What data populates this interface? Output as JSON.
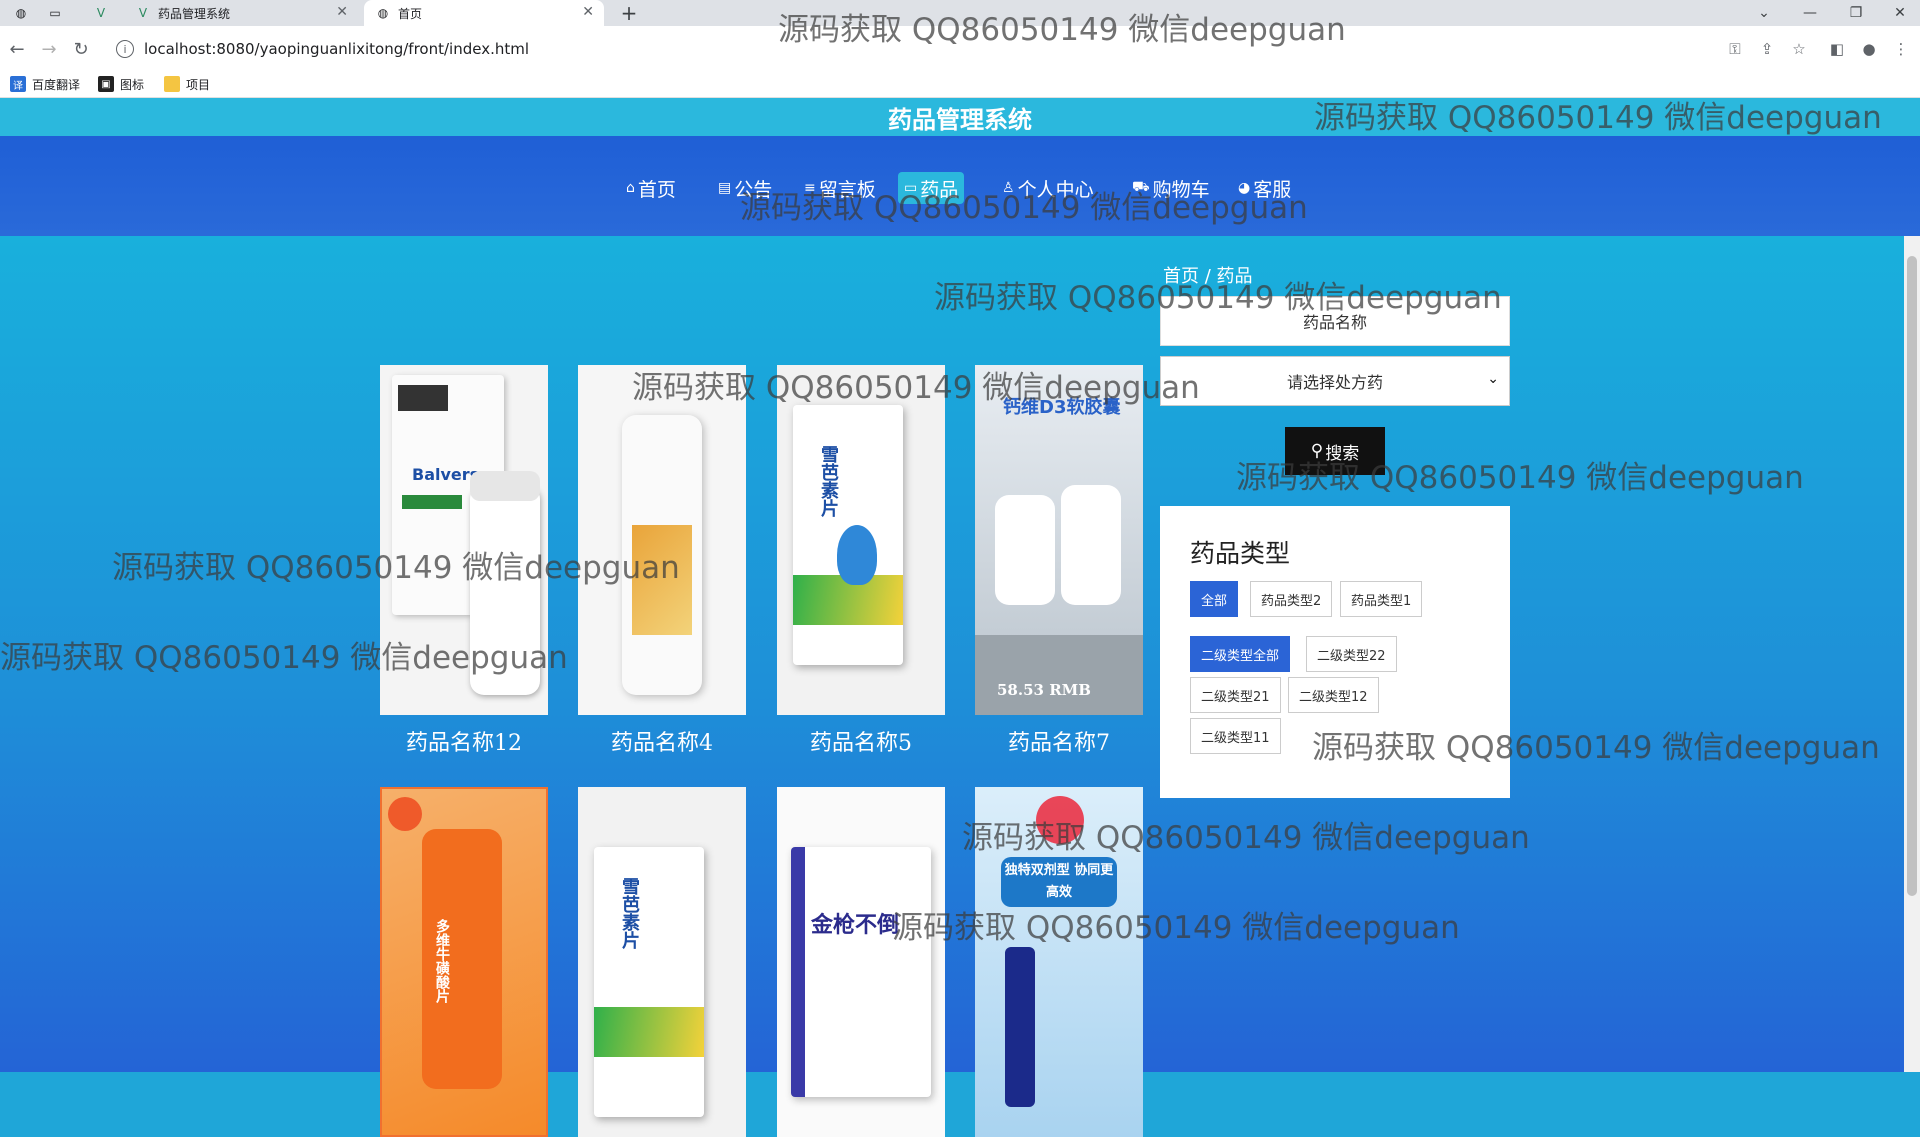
{
  "browser": {
    "tabs": [
      {
        "label": "药品管理系统",
        "active": false
      },
      {
        "label": "首页",
        "active": true
      }
    ],
    "url": "localhost:8080/yaopinguanlixitong/front/index.html",
    "bookmarks": [
      "百度翻译",
      "图标",
      "项目"
    ]
  },
  "site": {
    "title": "药品管理系统",
    "nav": [
      {
        "label": "首页",
        "icon": "home-icon",
        "active": false
      },
      {
        "label": "公告",
        "icon": "notice-icon",
        "active": false
      },
      {
        "label": "留言板",
        "icon": "message-icon",
        "active": false
      },
      {
        "label": "药品",
        "icon": "medicine-icon",
        "active": true
      },
      {
        "label": "个人中心",
        "icon": "user-icon",
        "active": false
      },
      {
        "label": "购物车",
        "icon": "cart-icon",
        "active": false
      },
      {
        "label": "客服",
        "icon": "service-icon",
        "active": false
      }
    ]
  },
  "breadcrumb": "首页 / 药品",
  "search": {
    "placeholder": "药品名称",
    "select_value": "请选择处方药",
    "button_label": "搜索"
  },
  "categories": {
    "title": "药品类型",
    "level1": [
      "全部",
      "药品类型2",
      "药品类型1"
    ],
    "level1_selected": 0,
    "level2": [
      "二级类型全部",
      "二级类型22",
      "二级类型21",
      "二级类型12",
      "二级类型11"
    ],
    "level2_selected": 0
  },
  "products": [
    {
      "name": "药品名称12",
      "image_text": "Balversa"
    },
    {
      "name": "药品名称4",
      "image_text": ""
    },
    {
      "name": "药品名称5",
      "image_text": "雪芭素片"
    },
    {
      "name": "药品名称7",
      "image_text": "钙维D3软胶囊",
      "price": "58.53 RMB"
    },
    {
      "name": "",
      "image_text": "多维牛磺酸片"
    },
    {
      "name": "",
      "image_text": "雪芭素片"
    },
    {
      "name": "",
      "image_text": "金枪不倒"
    },
    {
      "name": "",
      "image_text": "独特双剂型 协同更高效"
    }
  ],
  "watermark": "源码获取 QQ86050149 微信deepguan",
  "colors": {
    "title_bar": "#2bb8dd",
    "nav_bar": "#1f5fd6",
    "active_chip": "#2b64d6",
    "search_button": "#111111"
  }
}
